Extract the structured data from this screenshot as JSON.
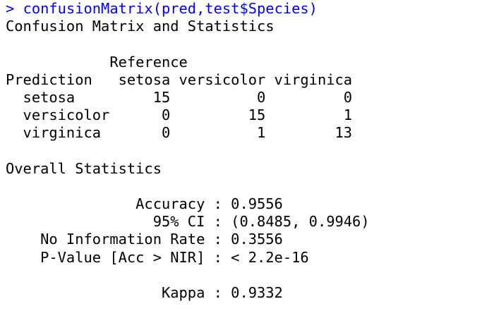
{
  "console": {
    "prompt": "> ",
    "command": "confusionMatrix(pred,test$Species)",
    "output_lines": [
      "Confusion Matrix and Statistics",
      "",
      "            Reference",
      "Prediction   setosa versicolor virginica",
      "  setosa         15          0         0",
      "  versicolor      0         15         1",
      "  virginica       0          1        13",
      "",
      "Overall Statistics",
      "",
      "               Accuracy : 0.9556",
      "                 95% CI : (0.8485, 0.9946)",
      "    No Information Rate : 0.3556",
      "    P-Value [Acc > NIR] : < 2.2e-16",
      "",
      "                  Kappa : 0.9332"
    ]
  },
  "colors": {
    "command": "#0000ff",
    "output": "#000000",
    "background": "#ffffff"
  }
}
